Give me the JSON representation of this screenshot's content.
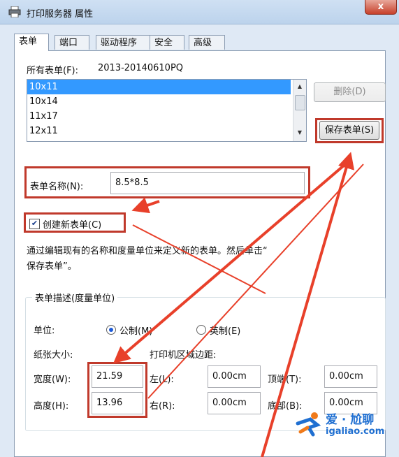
{
  "window": {
    "title": "打印服务器 属性",
    "close_label": "x"
  },
  "tabs": [
    {
      "label": "表单",
      "active": true
    },
    {
      "label": "端口"
    },
    {
      "label": "驱动程序"
    },
    {
      "label": "安全"
    },
    {
      "label": "高级"
    }
  ],
  "forms": {
    "all_forms_label": "所有表单(F):",
    "server_name": "2013-20140610PQ",
    "items": [
      "10x11",
      "10x14",
      "11x17",
      "12x11"
    ],
    "selected_index": 0,
    "delete_button": "删除(D)",
    "save_button": "保存表单(S)",
    "form_name_label": "表单名称(N):",
    "form_name_value": "8.5*8.5",
    "create_new_checkbox": "创建新表单(C)",
    "create_new_checked": true,
    "description_line1": "通过编辑现有的名称和度量单位来定义新的表单。然后单击“",
    "description_line2": "保存表单”。"
  },
  "measurements": {
    "group_title": "表单描述(度量单位)",
    "units_label": "单位:",
    "metric_label": "公制(M)",
    "english_label": "英制(E)",
    "selected_unit": "metric",
    "paper_size_label": "纸张大小:",
    "margins_label": "打印机区域边距:",
    "width_label": "宽度(W):",
    "width_value": "21.59",
    "height_label": "高度(H):",
    "height_value": "13.96",
    "left_label": "左(L):",
    "left_value": "0.00cm",
    "right_label": "右(R):",
    "right_value": "0.00cm",
    "top_label": "顶端(T):",
    "top_value": "0.00cm",
    "bottom_label": "底部(B):",
    "bottom_value": "0.00cm"
  },
  "watermark": {
    "brand": "爱 · 尬聊",
    "url": "igaliao.com"
  },
  "colors": {
    "annotation_red": "#c0392b",
    "selection_blue": "#3399ff"
  }
}
